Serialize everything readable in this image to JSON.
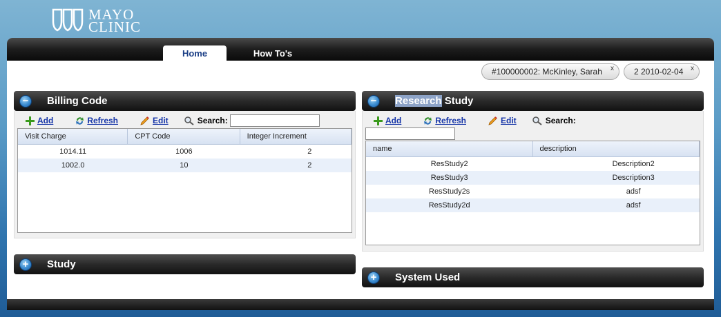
{
  "brand": {
    "line1": "MAYO",
    "line2": "CLINIC"
  },
  "tabs": [
    {
      "label": "Home"
    },
    {
      "label": "How To's"
    }
  ],
  "context": [
    {
      "label": "#100000002: McKinley, Sarah",
      "close": "x"
    },
    {
      "label": "2 2010-02-04",
      "close": "x"
    }
  ],
  "billing": {
    "title": "Billing Code",
    "toggle": "−",
    "add": "Add",
    "refresh": "Refresh",
    "edit": "Edit",
    "search": "Search:",
    "columns": [
      "Visit Charge",
      "CPT Code",
      "Integer Increment"
    ],
    "rows": [
      [
        "1014.11",
        "1006",
        "2"
      ],
      [
        "1002.0",
        "10",
        "2"
      ]
    ]
  },
  "research": {
    "title_highlight": "Research",
    "title_rest": " Study",
    "toggle": "−",
    "add": "Add",
    "refresh": "Refresh",
    "edit": "Edit",
    "search": "Search:",
    "columns": [
      "name",
      "description"
    ],
    "rows": [
      [
        "ResStudy2",
        "Description2"
      ],
      [
        "ResStudy3",
        "Description3"
      ],
      [
        "ResStudy2s",
        "adsf"
      ],
      [
        "ResStudy2d",
        "adsf"
      ]
    ]
  },
  "study": {
    "title": "Study",
    "toggle": "+"
  },
  "system": {
    "title": "System Used",
    "toggle": "+"
  },
  "colors": {
    "tab_active_text": "#1b3f86",
    "link": "#1736a8",
    "row_alt": "#e9f0fa",
    "toggle_blue": "#3a8bd0"
  }
}
